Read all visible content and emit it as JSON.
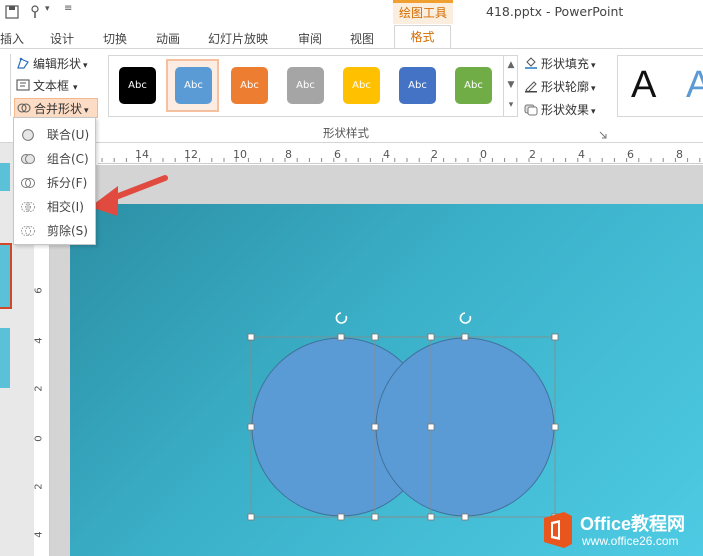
{
  "titlebar": {
    "drawing_tools_tab": "绘图工具",
    "document_title": "418.pptx - PowerPoint"
  },
  "tabs": [
    {
      "label": "插入"
    },
    {
      "label": "设计"
    },
    {
      "label": "切换"
    },
    {
      "label": "动画"
    },
    {
      "label": "幻灯片放映"
    },
    {
      "label": "审阅"
    },
    {
      "label": "视图"
    },
    {
      "label": "格式"
    }
  ],
  "ribbon": {
    "edit_shape": "编辑形状",
    "text_box": "文本框",
    "merge_shapes": "合并形状",
    "shape_styles_label": "形状样式",
    "shape_fill": "形状填充",
    "shape_outline": "形状轮廓",
    "shape_effects": "形状效果",
    "wordart_sample": "A",
    "swatches": [
      {
        "label": "Abc",
        "color": "#000000"
      },
      {
        "label": "Abc",
        "color": "#5b9bd5"
      },
      {
        "label": "Abc",
        "color": "#ed7d31"
      },
      {
        "label": "Abc",
        "color": "#a5a5a5"
      },
      {
        "label": "Abc",
        "color": "#ffc000"
      },
      {
        "label": "Abc",
        "color": "#4472c4"
      },
      {
        "label": "Abc",
        "color": "#70ad47"
      }
    ]
  },
  "merge_menu": {
    "items": [
      {
        "label": "联合(U)",
        "icon": "union-icon"
      },
      {
        "label": "组合(C)",
        "icon": "combine-icon"
      },
      {
        "label": "拆分(F)",
        "icon": "fragment-icon"
      },
      {
        "label": "相交(I)",
        "icon": "intersect-icon"
      },
      {
        "label": "剪除(S)",
        "icon": "subtract-icon"
      }
    ]
  },
  "rulers": {
    "horizontal": [
      "14",
      "12",
      "10",
      "8",
      "6",
      "4",
      "2",
      "0",
      "2",
      "4",
      "6",
      "8"
    ],
    "vertical": [
      "6",
      "4",
      "2",
      "0",
      "2",
      "4"
    ]
  },
  "colors": {
    "accent_orange": "#d46b00",
    "shape_fill": "#5b9bd5",
    "arrow": "#e04a3f"
  },
  "watermark": {
    "brand": "Office教程网",
    "url": "www.office26.com"
  }
}
